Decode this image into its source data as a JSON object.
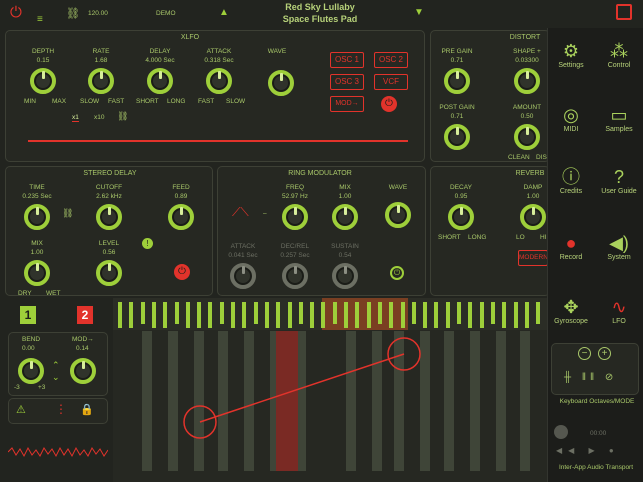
{
  "header": {
    "tempo": "120.00",
    "preset_bank": "DEMO",
    "song": "Red Sky Lullaby",
    "patch": "Space Flutes Pad"
  },
  "xlfo": {
    "title": "XLFO",
    "depth_label": "DEPTH",
    "depth_value": "0.15",
    "rate_label": "RATE",
    "rate_value": "1.68",
    "delay_label": "DELAY",
    "delay_value": "4.000 Sec",
    "attack_label": "ATTACK",
    "attack_value": "0.318 Sec",
    "wave_label": "WAVE",
    "min": "MIN",
    "max": "MAX",
    "slow": "SLOW",
    "fast": "FAST",
    "short": "SHORT",
    "long": "LONG",
    "fast2": "FAST",
    "slow2": "SLOW",
    "x1": "x1",
    "x10": "x10",
    "targets": [
      "OSC 1",
      "OSC 2",
      "OSC 3",
      "VCF",
      "MOD→"
    ]
  },
  "distort": {
    "title": "DISTORT",
    "pregain_label": "PRE GAIN",
    "pregain_value": "0.71",
    "shape_label": "SHAPE +",
    "shape_value": "0.03300",
    "postgain_label": "POST GAIN",
    "postgain_value": "0.71",
    "amount_label": "AMOUNT",
    "amount_value": "0.50",
    "clean": "CLEAN",
    "dist": "DIST"
  },
  "stereo_delay": {
    "title": "STEREO DELAY",
    "time_label": "TIME",
    "time_value": "0.235 Sec",
    "cutoff_label": "CUTOFF",
    "cutoff_value": "2.62 kHz",
    "feed_label": "FEED",
    "feed_value": "0.89",
    "mix_label": "MIX",
    "mix_value": "1.00",
    "level_label": "LEVEL",
    "level_value": "0.56",
    "dry": "DRY",
    "wet": "WET"
  },
  "ring_mod": {
    "title": "RING MODULATOR",
    "freq_label": "FREQ",
    "freq_value": "52.97 Hz",
    "mix_label": "MIX",
    "mix_value": "1.00",
    "wave_label": "WAVE",
    "attack_label": "ATTACK",
    "attack_value": "0.041 Sec",
    "decrel_label": "DEC/REL",
    "decrel_value": "0.257 Sec",
    "sustain_label": "SUSTAIN",
    "sustain_value": "0.54"
  },
  "reverb": {
    "title": "REVERB",
    "decay_label": "DECAY",
    "decay_value": "0.95",
    "damp_label": "DAMP",
    "damp_value": "1.00",
    "short": "SHORT",
    "long": "LONG",
    "lo": "LO",
    "hi": "HI",
    "mode": "MODERN"
  },
  "perf": {
    "bank1": "1",
    "bank2": "2",
    "bend_label": "BEND",
    "bend_value": "0.00",
    "mod_label": "MOD→",
    "mod_value": "0.14",
    "minus3": "-3",
    "plus3": "+3"
  },
  "sidebar": {
    "items": [
      "Settings",
      "Control",
      "MIDI",
      "Samples",
      "Credits",
      "User Guide",
      "Record",
      "System",
      "Gyroscope",
      "LFO"
    ],
    "octaves": "Keyboard Octaves/MODE",
    "transport_time": "00:00",
    "iaa": "Inter-App Audio Transport"
  },
  "colors": {
    "accent": "#9ecf3a",
    "red": "#e2332b",
    "bg": "#22241f"
  }
}
